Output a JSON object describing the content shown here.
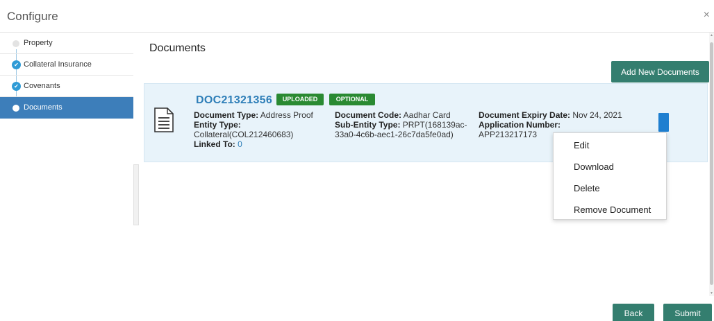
{
  "header": {
    "title": "Configure",
    "close": "×"
  },
  "sidebar": {
    "items": [
      {
        "label": "Property",
        "state": "pending"
      },
      {
        "label": "Collateral Insurance",
        "state": "complete"
      },
      {
        "label": "Covenants",
        "state": "complete"
      },
      {
        "label": "Documents",
        "state": "active"
      }
    ]
  },
  "main": {
    "title": "Documents",
    "add_button": "Add New Documents",
    "document": {
      "id": "DOC21321356",
      "status_badge": "UPLOADED",
      "requirement_badge": "OPTIONAL",
      "type_label": "Document Type:",
      "type_value": "Address Proof",
      "entity_label": "Entity Type:",
      "entity_value": "Collateral(COL212460683)",
      "linked_label": "Linked To:",
      "linked_value": "0",
      "code_label": "Document Code:",
      "code_value": "Aadhar Card",
      "subentity_label": "Sub-Entity Type:",
      "subentity_value_1": "PRPT(168139ac-",
      "subentity_value_2": "33a0-4c6b-aec1-26c7da5fe0ad)",
      "expiry_label": "Document Expiry Date:",
      "expiry_value": "Nov 24, 2021",
      "appno_label": "Application Number:",
      "appno_value": "APP213217173"
    },
    "menu": [
      "Edit",
      "Download",
      "Delete",
      "Remove Document"
    ]
  },
  "footer": {
    "back": "Back",
    "submit": "Submit"
  },
  "colors": {
    "primary_button": "#347e6f",
    "link": "#2f7fb8",
    "active_step": "#3d7eba",
    "badge": "#2a8a32",
    "card_bg": "#e8f3fa"
  }
}
